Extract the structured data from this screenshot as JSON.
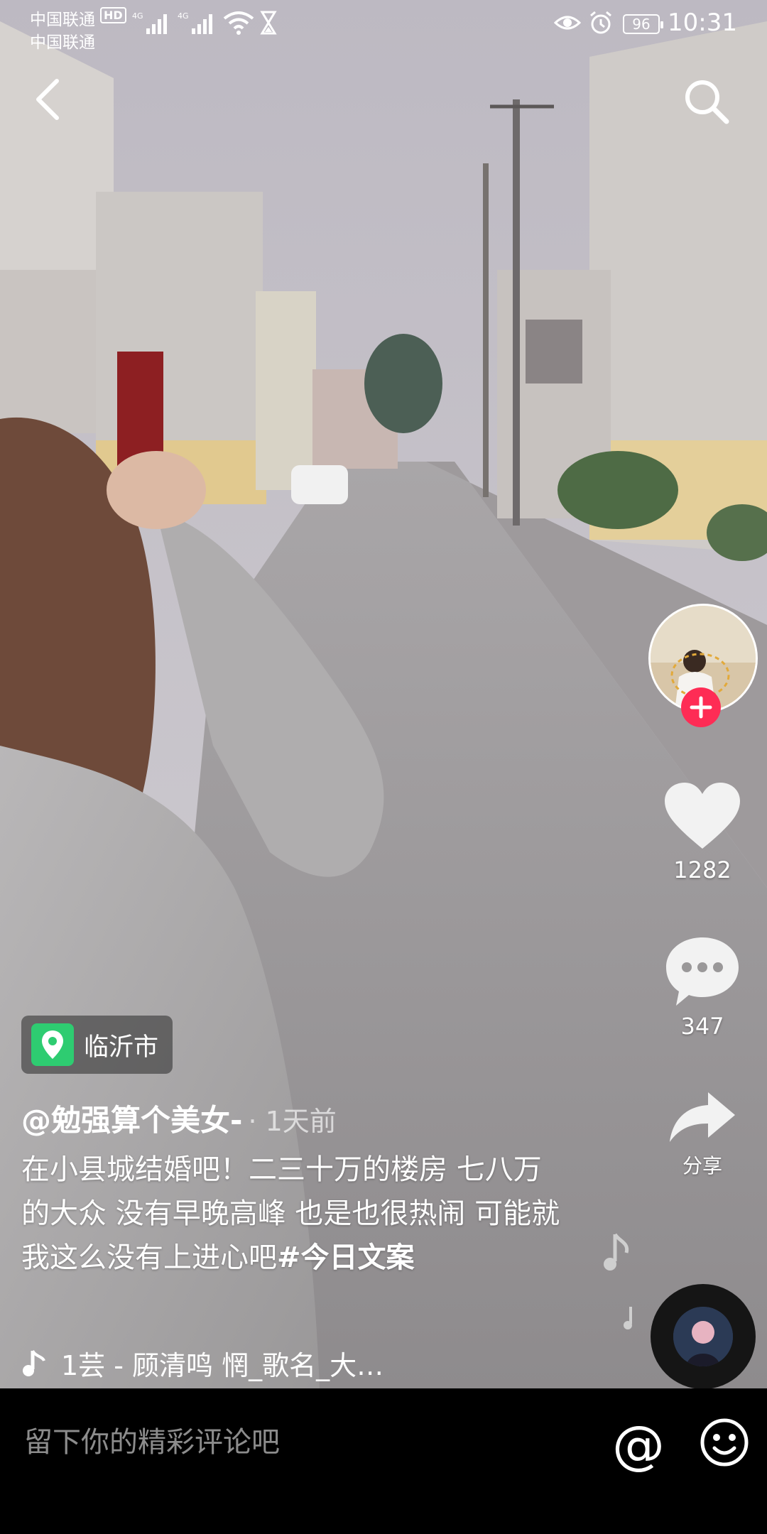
{
  "status_bar": {
    "carrier_1": "中国联通",
    "hd_badge": "HD",
    "carrier_2": "中国联通",
    "network_1": "4G",
    "network_2": "4G",
    "battery": "96",
    "time": "10:31"
  },
  "nav": {
    "back_icon": "chevron-left-icon",
    "search_icon": "search-icon"
  },
  "actions": {
    "follow_icon": "plus-icon",
    "like_count": "1282",
    "comment_count": "347",
    "share_label": "分享"
  },
  "video_info": {
    "location": "临沂市",
    "author": "@勉强算个美女-",
    "time_ago": "· 1天前",
    "caption_text": "在小县城结婚吧！二三十万的楼房 七八万的大众 没有早晚高峰 也是也很热闹 可能就我这么没有上进心吧",
    "hashtag": "#今日文案",
    "music": "1芸 - 顾清鸣    惘_歌名_大…"
  },
  "comment_bar": {
    "placeholder": "留下你的精彩评论吧",
    "at_label": "@",
    "emoji_icon": "smiley-icon"
  },
  "colors": {
    "follow_red": "#fe2c55",
    "location_green": "#2ecc71"
  }
}
